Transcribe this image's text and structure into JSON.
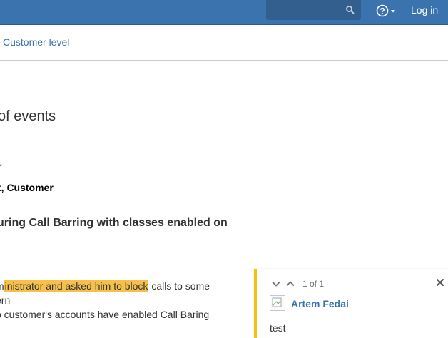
{
  "header": {
    "search": {
      "value": "",
      "placeholder": ""
    },
    "help_icon": "help-circle-icon",
    "login_label": "Log in"
  },
  "breadcrumb": {
    "label": "Customer level"
  },
  "content": {
    "heading": "of events",
    "bold_line_1": "r",
    "bold_line_2": "t, Customer",
    "subheading": "uring Call Barring with classes enabled on",
    "paragraph": {
      "line1_prefix": "m",
      "line1_highlight": "inistrator and asked him to block",
      "line1_suffix": " calls to some",
      "line2": "ern",
      "line3": "o customer's accounts have enabled Call Baring"
    }
  },
  "comment_panel": {
    "counter": "1 of 1",
    "author": "Artem Fedai",
    "text": "test",
    "accent_color": "#f1c40f"
  },
  "colors": {
    "header_bg": "#3b73af",
    "link": "#3b73af",
    "highlight": "#f5c14a"
  }
}
